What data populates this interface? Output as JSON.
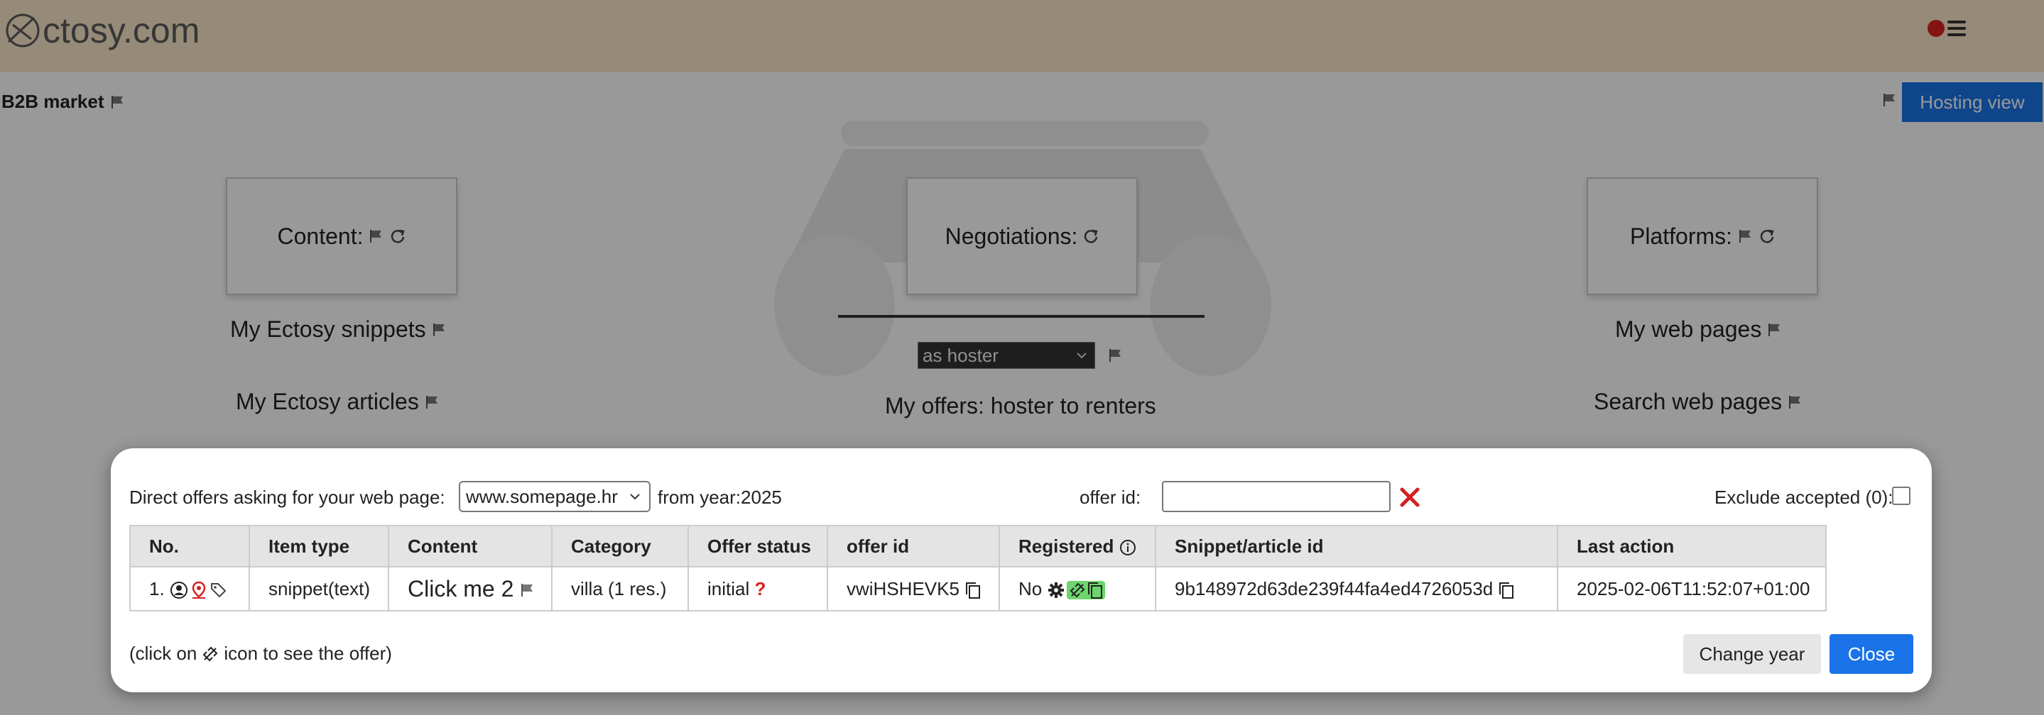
{
  "app": {
    "logo_text": "ctosy.com"
  },
  "header": {
    "section_title": "B2B market",
    "hosting_view_label": "Hosting view"
  },
  "cards": {
    "content_label": "Content:",
    "negotiations_label": "Negotiations:",
    "platforms_label": "Platforms:"
  },
  "links": {
    "my_snippets": "My Ectosy snippets",
    "my_articles": "My Ectosy articles",
    "my_web_pages": "My web pages",
    "search_web_pages": "Search web pages",
    "my_offers": "My offers: hoster to renters"
  },
  "role_select": {
    "value": "as hoster"
  },
  "modal": {
    "direct_label": "Direct offers asking for your web page:",
    "page_select_value": "www.somepage.hr",
    "from_year_label": "from year:2025",
    "offer_id_label": "offer id:",
    "offer_id_value": "",
    "exclude_label": "Exclude accepted (0):",
    "exclude_checked": false,
    "columns": [
      "No.",
      "Item type",
      "Content",
      "Category",
      "Offer status",
      "offer id",
      "Registered",
      "Snippet/article id",
      "Last action"
    ],
    "rows": [
      {
        "no": "1.",
        "item_type": "snippet(text)",
        "content": "Click me 2",
        "category": "villa (1 res.)",
        "offer_status": "initial",
        "offer_id": "vwiHSHEVK5",
        "registered": "No",
        "snippet_id": "9b148972d63de239f44fa4ed4726053d",
        "last_action": "2025-02-06T11:52:07+01:00"
      }
    ],
    "hint_prefix": "(click on",
    "hint_suffix": "icon to see the offer)",
    "change_year_label": "Change year",
    "close_label": "Close"
  },
  "colors": {
    "accent": "#1a73e8",
    "header_bg": "#fbe7c8",
    "alert_red": "#d42020",
    "green_badge": "#6ed46e"
  }
}
